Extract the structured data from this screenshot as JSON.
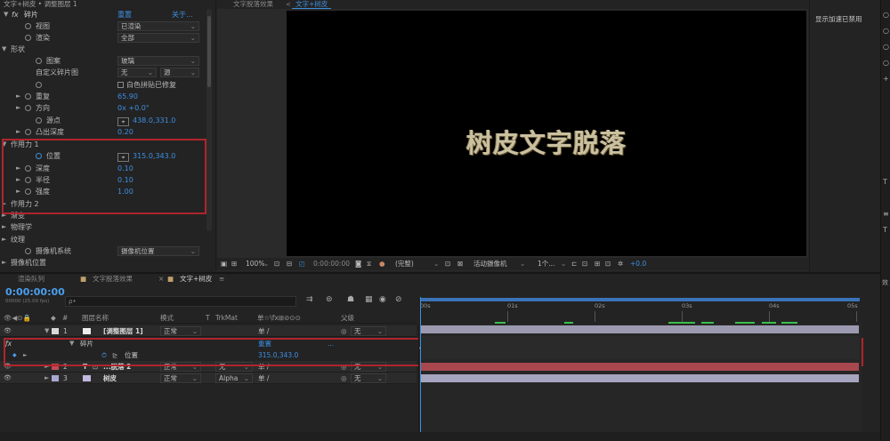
{
  "effects_panel": {
    "header": "文字+树皮 • 调整图层 1",
    "effect_name": "碎片",
    "reset": "重置",
    "about": "关于...",
    "rows": [
      {
        "label": "视图",
        "value": "已渲染",
        "kind": "dropdown"
      },
      {
        "label": "渲染",
        "value": "全部",
        "kind": "dropdown"
      },
      {
        "label": "形状",
        "kind": "group"
      },
      {
        "label": "图案",
        "value": "玻璃",
        "kind": "dropdown"
      },
      {
        "label": "自定义碎片图",
        "value": "无",
        "value2": "源",
        "kind": "dropdown2"
      },
      {
        "label": "",
        "value": "白色拼贴已修复",
        "kind": "checkbox"
      },
      {
        "label": "重复",
        "value": "65.90",
        "kind": "value"
      },
      {
        "label": "方向",
        "value": "0x +0.0°",
        "kind": "value"
      },
      {
        "label": "源点",
        "value": "438.0,331.0",
        "kind": "point"
      },
      {
        "label": "凸出深度",
        "value": "0.20",
        "kind": "value"
      },
      {
        "label": "作用力 1",
        "kind": "group"
      },
      {
        "label": "位置",
        "value": "315.0,343.0",
        "kind": "point"
      },
      {
        "label": "深度",
        "value": "0.10",
        "kind": "value"
      },
      {
        "label": "半径",
        "value": "0.10",
        "kind": "value"
      },
      {
        "label": "强度",
        "value": "1.00",
        "kind": "value"
      },
      {
        "label": "作用力 2",
        "kind": "group"
      },
      {
        "label": "渐变",
        "kind": "group"
      },
      {
        "label": "物理学",
        "kind": "group"
      },
      {
        "label": "纹理",
        "kind": "group"
      },
      {
        "label": "摄像机系统",
        "value": "摄像机位置",
        "kind": "dropdown"
      },
      {
        "label": "摄像机位置",
        "kind": "group"
      }
    ]
  },
  "comp_panel": {
    "tabs": [
      "文字脱落效果",
      "文字+树皮"
    ],
    "canvas_text": "树皮文字脱落",
    "footer": {
      "zoom": "100%",
      "timecode": "0:00:00:00",
      "resolution": "(完整)",
      "camera": "活动摄像机",
      "views": "1个...",
      "exposure": "+0.0"
    }
  },
  "right_panel": {
    "text": "显示加速已禁用"
  },
  "timeline": {
    "tabs": [
      "渲染队列",
      "文字脱落效果",
      "文字+树皮"
    ],
    "timecode": "0:00:00:00",
    "timecode_sub": "00000 (25.00 fps)",
    "search_placeholder": "ρ•",
    "columns": {
      "num": "#",
      "name": "图层名称",
      "mode": "模式",
      "t": "T",
      "trkmat": "TrkMat",
      "switches": "单☆\\fx⊞⊘⊙⊙",
      "parent": "父级"
    },
    "layers": [
      {
        "num": "1",
        "name": "[调整图层 1]",
        "mode": "正常",
        "trkmat": "",
        "parent": "无",
        "color": "#d8d8d8"
      },
      {
        "num": "2",
        "name": "...脱落 2",
        "mode": "正常",
        "trkmat": "无",
        "parent": "无",
        "color": "#c24b54",
        "type": "T"
      },
      {
        "num": "3",
        "name": "树皮",
        "mode": "正常",
        "trkmat": "Alpha",
        "parent": "无",
        "color": "#a9a9cf"
      }
    ],
    "effect_row": {
      "label": "碎片",
      "reset": "重置",
      "dots": "..."
    },
    "property_row": {
      "label": "位置",
      "value": "315.0,343.0"
    },
    "ruler": [
      "00s",
      "01s",
      "02s",
      "03s",
      "04s",
      "05s"
    ],
    "right_panel_label": "效"
  },
  "colors": {
    "accent": "#3d8fe0",
    "highlight_box": "#b0252b",
    "layer2_bar": "#a8474e",
    "layer1_bar": "#9c9ab0",
    "layer3_bar": "#a6a5bf",
    "work_area": "#4a9ff0"
  }
}
